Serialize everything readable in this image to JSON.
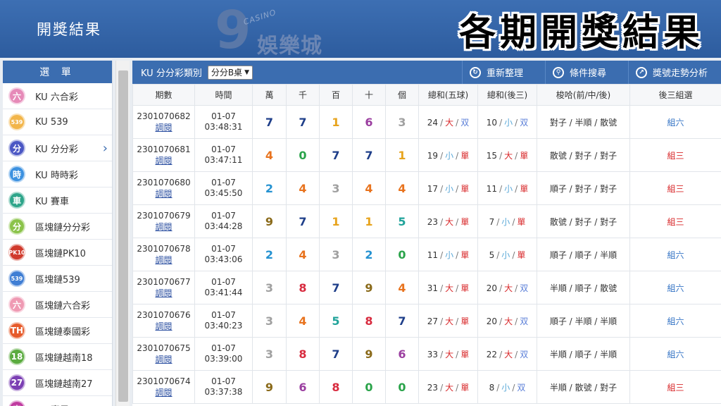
{
  "header": {
    "subtitle": "開獎結果",
    "logo_digit": "9",
    "logo_casino": "CASINO",
    "logo_brand": "娛樂城",
    "headline": "各期開獎結果"
  },
  "sidebar": {
    "title": "選 單",
    "items": [
      {
        "icon": "六",
        "label": "KU 六合彩",
        "color": "#e68ab8"
      },
      {
        "icon": "539",
        "label": "KU 539",
        "color": "#f2b54a"
      },
      {
        "icon": "分",
        "label": "KU 分分彩",
        "color": "#4b57c4",
        "active": true
      },
      {
        "icon": "時",
        "label": "KU 時時彩",
        "color": "#3c91e0"
      },
      {
        "icon": "車",
        "label": "KU 賽車",
        "color": "#2ea58a"
      },
      {
        "icon": "分",
        "label": "區塊鏈分分彩",
        "color": "#8bc34a"
      },
      {
        "icon": "PK10",
        "label": "區塊鏈PK10",
        "color": "#d03a2c"
      },
      {
        "icon": "539",
        "label": "區塊鏈539",
        "color": "#3f7ed4"
      },
      {
        "icon": "六",
        "label": "區塊鏈六合彩",
        "color": "#ef9ab3"
      },
      {
        "icon": "TH",
        "label": "區塊鏈泰國彩",
        "color": "#e65a2a"
      },
      {
        "icon": "18",
        "label": "區塊鏈越南18",
        "color": "#5aab3f"
      },
      {
        "icon": "27",
        "label": "區塊鏈越南27",
        "color": "#7b3fb3"
      },
      {
        "icon": "車",
        "label": "KU 賽馬",
        "color": "#c03aa0"
      }
    ]
  },
  "toolbar": {
    "title": "KU 分分彩類別",
    "select_value": "分分B桌",
    "refresh": "重新整理",
    "search": "條件搜尋",
    "trend": "獎號走勢分析"
  },
  "table": {
    "headers": [
      "期數",
      "時間",
      "萬",
      "千",
      "百",
      "十",
      "個",
      "總和(五球)",
      "總和(後三)",
      "梭哈(前/中/後)",
      "後三組選"
    ],
    "link_label": "調閱",
    "rows": [
      {
        "issue": "2301070682",
        "date": "01-07",
        "time": "03:48:31",
        "balls": [
          7,
          7,
          1,
          6,
          3
        ],
        "sum5": "24",
        "sum5_size": "大",
        "sum5_parity": "双",
        "sum3": "10",
        "sum3_size": "小",
        "sum3_parity": "双",
        "suoha": "對子 / 半順 / 散號",
        "group": "組六"
      },
      {
        "issue": "2301070681",
        "date": "01-07",
        "time": "03:47:11",
        "balls": [
          4,
          0,
          7,
          7,
          1
        ],
        "sum5": "19",
        "sum5_size": "小",
        "sum5_parity": "單",
        "sum3": "15",
        "sum3_size": "大",
        "sum3_parity": "單",
        "suoha": "散號 / 對子 / 對子",
        "group": "組三"
      },
      {
        "issue": "2301070680",
        "date": "01-07",
        "time": "03:45:50",
        "balls": [
          2,
          4,
          3,
          4,
          4
        ],
        "sum5": "17",
        "sum5_size": "小",
        "sum5_parity": "單",
        "sum3": "11",
        "sum3_size": "小",
        "sum3_parity": "單",
        "suoha": "順子 / 對子 / 對子",
        "group": "組三"
      },
      {
        "issue": "2301070679",
        "date": "01-07",
        "time": "03:44:28",
        "balls": [
          9,
          7,
          1,
          1,
          5
        ],
        "sum5": "23",
        "sum5_size": "大",
        "sum5_parity": "單",
        "sum3": "7",
        "sum3_size": "小",
        "sum3_parity": "單",
        "suoha": "散號 / 對子 / 對子",
        "group": "組三"
      },
      {
        "issue": "2301070678",
        "date": "01-07",
        "time": "03:43:06",
        "balls": [
          2,
          4,
          3,
          2,
          0
        ],
        "sum5": "11",
        "sum5_size": "小",
        "sum5_parity": "單",
        "sum3": "5",
        "sum3_size": "小",
        "sum3_parity": "單",
        "suoha": "順子 / 順子 / 半順",
        "group": "組六"
      },
      {
        "issue": "2301070677",
        "date": "01-07",
        "time": "03:41:44",
        "balls": [
          3,
          8,
          7,
          9,
          4
        ],
        "sum5": "31",
        "sum5_size": "大",
        "sum5_parity": "單",
        "sum3": "20",
        "sum3_size": "大",
        "sum3_parity": "双",
        "suoha": "半順 / 順子 / 散號",
        "group": "組六"
      },
      {
        "issue": "2301070676",
        "date": "01-07",
        "time": "03:40:23",
        "balls": [
          3,
          4,
          5,
          8,
          7
        ],
        "sum5": "27",
        "sum5_size": "大",
        "sum5_parity": "單",
        "sum3": "20",
        "sum3_size": "大",
        "sum3_parity": "双",
        "suoha": "順子 / 半順 / 半順",
        "group": "組六"
      },
      {
        "issue": "2301070675",
        "date": "01-07",
        "time": "03:39:00",
        "balls": [
          3,
          8,
          7,
          9,
          6
        ],
        "sum5": "33",
        "sum5_size": "大",
        "sum5_parity": "單",
        "sum3": "22",
        "sum3_size": "大",
        "sum3_parity": "双",
        "suoha": "半順 / 順子 / 半順",
        "group": "組六"
      },
      {
        "issue": "2301070674",
        "date": "01-07",
        "time": "03:37:38",
        "balls": [
          9,
          6,
          8,
          0,
          0
        ],
        "sum5": "23",
        "sum5_size": "大",
        "sum5_parity": "單",
        "sum3": "8",
        "sum3_size": "小",
        "sum3_parity": "双",
        "suoha": "半順 / 散號 / 對子",
        "group": "組三"
      }
    ]
  }
}
